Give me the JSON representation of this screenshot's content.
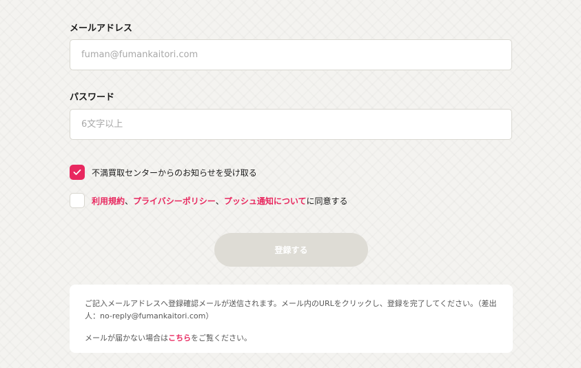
{
  "form": {
    "email_label": "メールアドレス",
    "email_placeholder": "fuman@fumankaitori.com",
    "password_label": "パスワード",
    "password_placeholder": "6文字以上",
    "newsletter_label": "不満買取センターからのお知らせを受け取る",
    "newsletter_checked": true,
    "terms_checked": false,
    "terms": {
      "link1": "利用規約",
      "sep1": "、",
      "link2": "プライバシーポリシー",
      "sep2": "、",
      "link3": "プッシュ通知について",
      "suffix": "に同意する"
    },
    "submit_label": "登録する"
  },
  "notice": {
    "line1": "ご記入メールアドレスへ登録確認メールが送信されます。メール内のURLをクリックし、登録を完了してください。（差出人：no-reply@fumankaitori.com）",
    "line2_prefix": "メールが届かない場合は",
    "line2_link": "こちら",
    "line2_suffix": "をご覧ください。"
  },
  "colors": {
    "accent": "#e8285f",
    "button_disabled": "#dedcd5",
    "background": "#f4f3f0"
  }
}
